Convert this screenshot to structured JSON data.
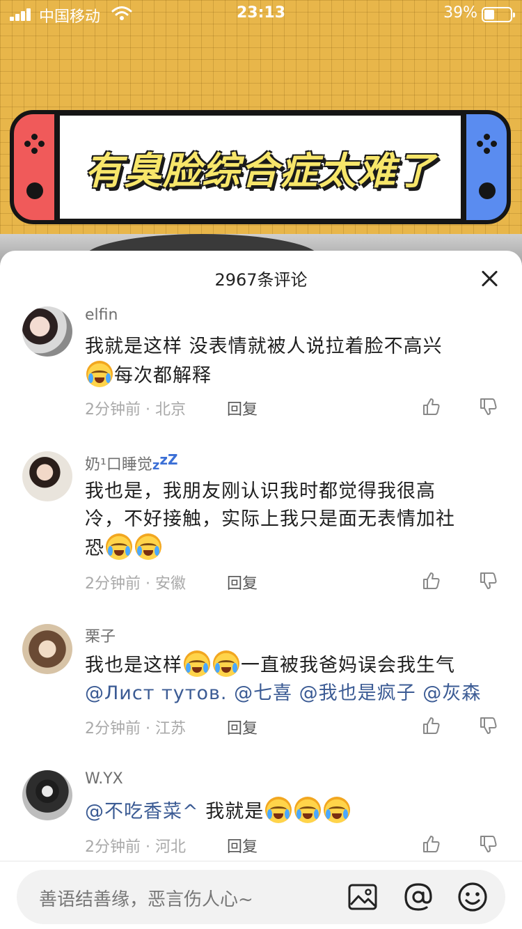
{
  "status_bar": {
    "carrier": "中国移动",
    "time": "23:13",
    "battery": "39%"
  },
  "video": {
    "banner_text": "有臭脸综合症太难了"
  },
  "sheet": {
    "title": "2967条评论"
  },
  "comments": [
    {
      "username": "elfin",
      "text_parts": [
        "我就是这样 没表情就被人说拉着脸不高兴"
      ],
      "line2": "每次都解释",
      "time": "2分钟前",
      "location": "北京",
      "reply": "回复"
    },
    {
      "username": "奶¹口睡觉",
      "zzz": "zzz",
      "line1": "我也是，我朋友刚认识我时都觉得我很高",
      "line2": "冷，不好接触，实际上我只是面无表情加社",
      "line3": "恐",
      "time": "2分钟前",
      "location": "安徽",
      "reply": "回复"
    },
    {
      "username": "栗子",
      "line1_a": "我也是这样",
      "line1_b": "一直被我爸妈误会我生气",
      "mentions": [
        "@Лист тутов.",
        "@七喜",
        "@我也是疯子",
        "@灰森"
      ],
      "time": "2分钟前",
      "location": "江苏",
      "reply": "回复"
    },
    {
      "username": "W.YX",
      "mention": "@不吃香菜^",
      "text": " 我就是",
      "time": "2分钟前",
      "location": "河北",
      "reply": "回复"
    }
  ],
  "input": {
    "placeholder": "善语结善缘，恶言伤人心~"
  },
  "colors": {
    "mention": "#3b5b94",
    "accent_blue": "#3b6fd6"
  }
}
